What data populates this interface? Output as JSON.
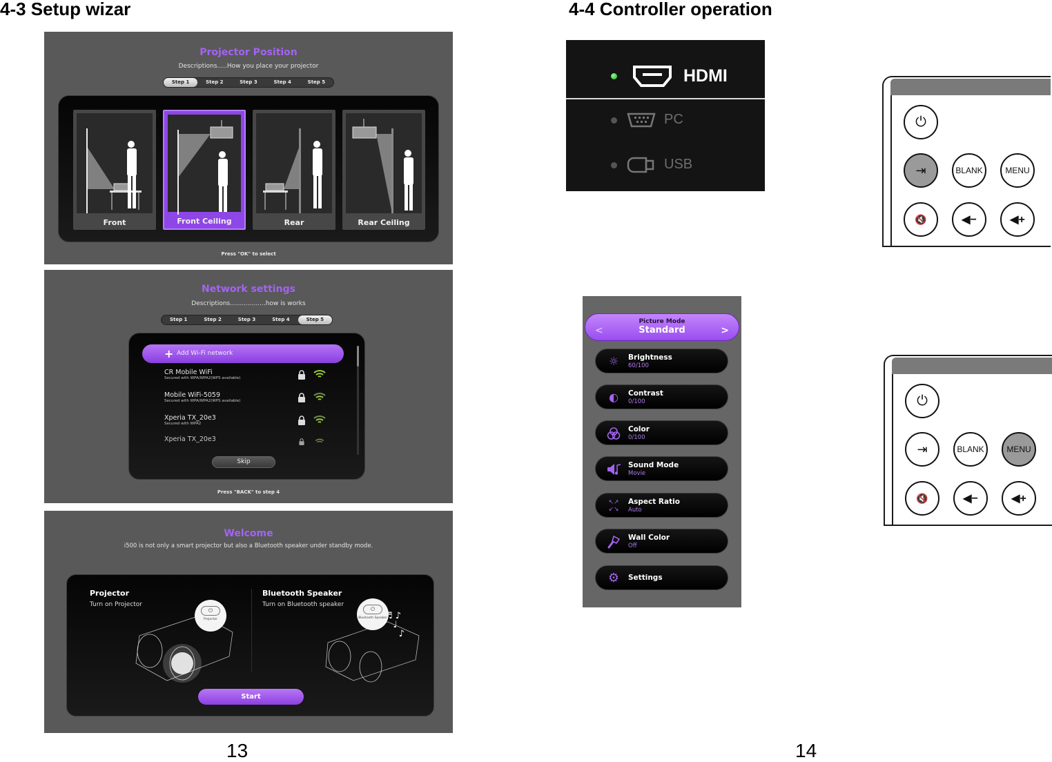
{
  "left_page": {
    "heading": "4-3 Setup wizar",
    "page_number": "13",
    "projector_position": {
      "title": "Projector Position",
      "description": "Descriptions.....How you place your projector",
      "steps": [
        "Step 1",
        "Step 2",
        "Step 3",
        "Step 4",
        "Step 5"
      ],
      "active_step": 1,
      "options": [
        {
          "label": "Front",
          "selected": false
        },
        {
          "label": "Front Ceiling",
          "selected": true
        },
        {
          "label": "Rear",
          "selected": false
        },
        {
          "label": "Rear Ceiling",
          "selected": false
        }
      ],
      "hint": "Press \"OK\" to select"
    },
    "network_settings": {
      "title": "Network settings",
      "description": "Descriptions..................how is works",
      "steps": [
        "Step 1",
        "Step 2",
        "Step 3",
        "Step 4",
        "Step 5"
      ],
      "active_step": 5,
      "add_network_label": "Add Wi-Fi network",
      "networks": [
        {
          "name": "CR Mobile WiFi",
          "security": "Secured with WPA/WPA2(WPS available)"
        },
        {
          "name": "Mobile WiFi-5059",
          "security": "Secured with WPA/WPA2(WPS available)"
        },
        {
          "name": "Xperia TX_20e3",
          "security": "Secured with WPA2"
        },
        {
          "name": "Xperia TX_20e3",
          "security": ""
        }
      ],
      "skip_label": "Skip",
      "hint": "Press \"BACK\" to step 4"
    },
    "welcome": {
      "title": "Welcome",
      "description": "i500 is not only a smart projector but also a Bluetooth speaker under standby mode.",
      "projector": {
        "title": "Projector",
        "subtitle": "Turn on Projector",
        "button_caption": "Projector"
      },
      "speaker": {
        "title": "Bluetooth Speaker",
        "subtitle": "Turn on Bluetooth speaker",
        "button_caption": "Bluetooth Speaker"
      },
      "start_label": "Start"
    }
  },
  "right_page": {
    "heading": "4-4 Controller operation",
    "page_number": "14",
    "sources": [
      {
        "label": "HDMI",
        "icon": "hdmi-port-icon",
        "active": true
      },
      {
        "label": "PC",
        "icon": "vga-port-icon",
        "active": false
      },
      {
        "label": "USB",
        "icon": "usb-port-icon",
        "active": false
      }
    ],
    "remote_top": {
      "highlighted": "source",
      "buttons": {
        "power": "⏻",
        "source": "⇥",
        "blank": "BLANK",
        "menu": "MENU",
        "mute": "🔇",
        "vol_down": "◀−",
        "vol_up": "◀+"
      }
    },
    "remote_bottom": {
      "highlighted": "menu",
      "buttons": {
        "power": "⏻",
        "source": "⇥",
        "blank": "BLANK",
        "menu": "MENU",
        "mute": "🔇",
        "vol_down": "◀−",
        "vol_up": "◀+"
      }
    },
    "quick_menu": {
      "mode_label": "Picture Mode",
      "mode_value": "Standard",
      "prev_arrow": "<",
      "next_arrow": ">",
      "items": [
        {
          "name": "Brightness",
          "value": "60/100",
          "icon": "sun-icon"
        },
        {
          "name": "Contrast",
          "value": "0/100",
          "icon": "contrast-icon"
        },
        {
          "name": "Color",
          "value": "0/100",
          "icon": "color-circles-icon"
        },
        {
          "name": "Sound Mode",
          "value": "Movie",
          "icon": "speaker-music-icon"
        },
        {
          "name": "Aspect Ratio",
          "value": "Auto",
          "icon": "aspect-arrows-icon"
        },
        {
          "name": "Wall Color",
          "value": "Off",
          "icon": "paintbrush-icon"
        },
        {
          "name": "Settings",
          "value": "",
          "icon": "gear-icon"
        }
      ]
    }
  },
  "colors": {
    "accent_purple": "#a463f2",
    "screen_bg": "#595959",
    "active_source_green": "#3fd13f"
  }
}
